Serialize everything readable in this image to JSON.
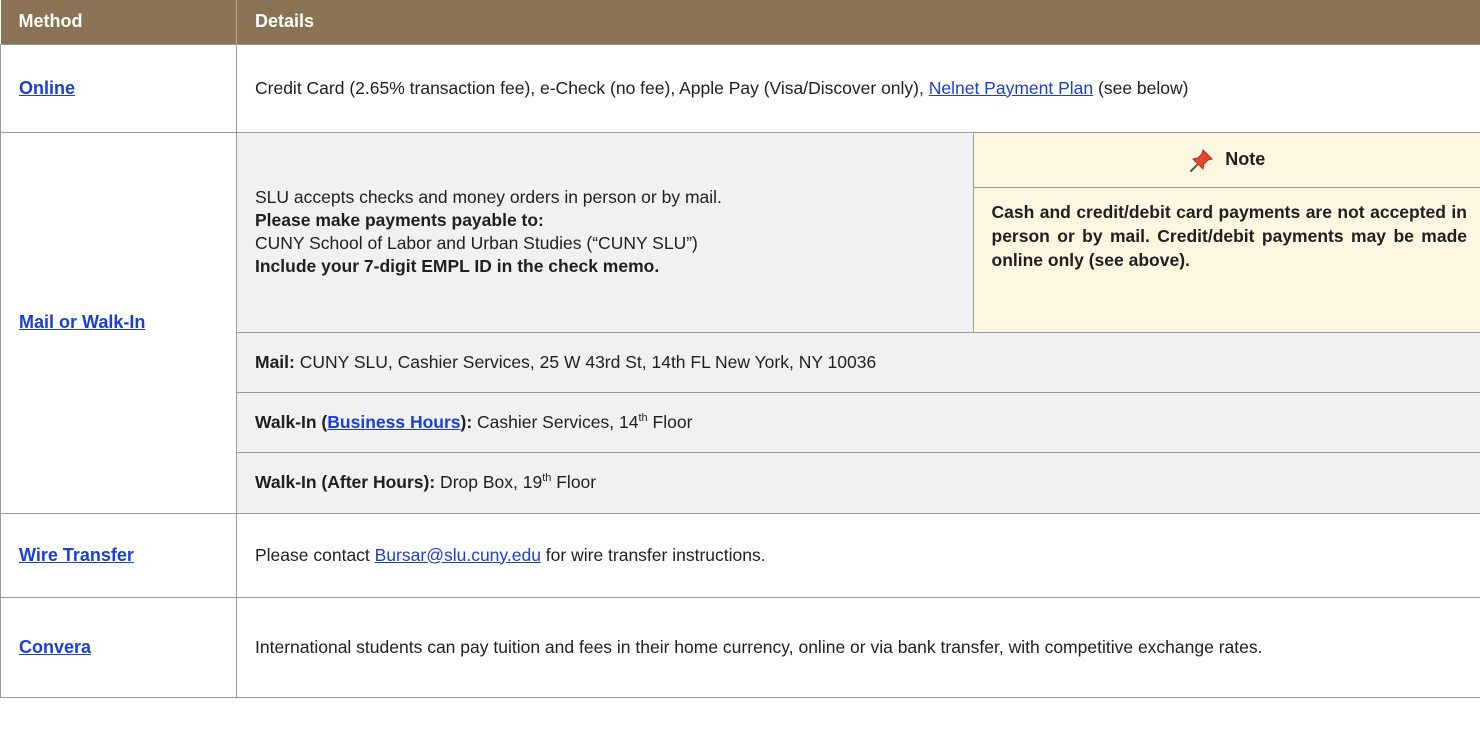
{
  "header": {
    "method": "Method",
    "details": "Details"
  },
  "online": {
    "method": "Online",
    "text": "Credit Card (2.65% transaction fee), e-Check (no fee), Apple Pay (Visa/Discover only), ",
    "plan_link": "Nelnet Payment Plan",
    "suffix": " (see below)"
  },
  "mail": {
    "method": "Mail or Walk-In",
    "accept_line": "SLU accepts checks and money orders in person or by mail.",
    "payable_label": "Please make payments payable to:",
    "payable_to": "CUNY School of Labor and Urban Studies (“CUNY SLU”)",
    "memo": "Include your 7-digit EMPL ID in the check memo.",
    "note_title": "Note",
    "note_body": "Cash and credit/debit card payments are not accepted in person or by mail. Credit/debit payments may be made online only (see above).",
    "mail_label": "Mail:",
    "mail_address": " CUNY SLU, Cashier Services, 25 W 43rd St, 14th FL New York, NY 10036",
    "walkin_label": "Walk-In (",
    "business_hours": "Business Hours",
    "walkin_close": "):",
    "walkin_text": " Cashier Services, 14",
    "walkin_sup": "th",
    "walkin_floor": " Floor",
    "after_label": "Walk-In (After Hours):",
    "after_text": " Drop Box, 19",
    "after_sup": "th",
    "after_floor": " Floor"
  },
  "wire": {
    "method": "Wire Transfer",
    "prefix": "Please contact ",
    "email": "Bursar@slu.cuny.edu",
    "suffix": " for wire transfer instructions."
  },
  "convera": {
    "method": "Convera",
    "text": "International students can pay tuition and fees in their home currency, online or via bank transfer, with competitive exchange rates."
  },
  "colors": {
    "header_bg": "#8a7354",
    "link": "#1a3fd6",
    "note_bg": "#fdf6e0",
    "pin": "#e8452c"
  }
}
